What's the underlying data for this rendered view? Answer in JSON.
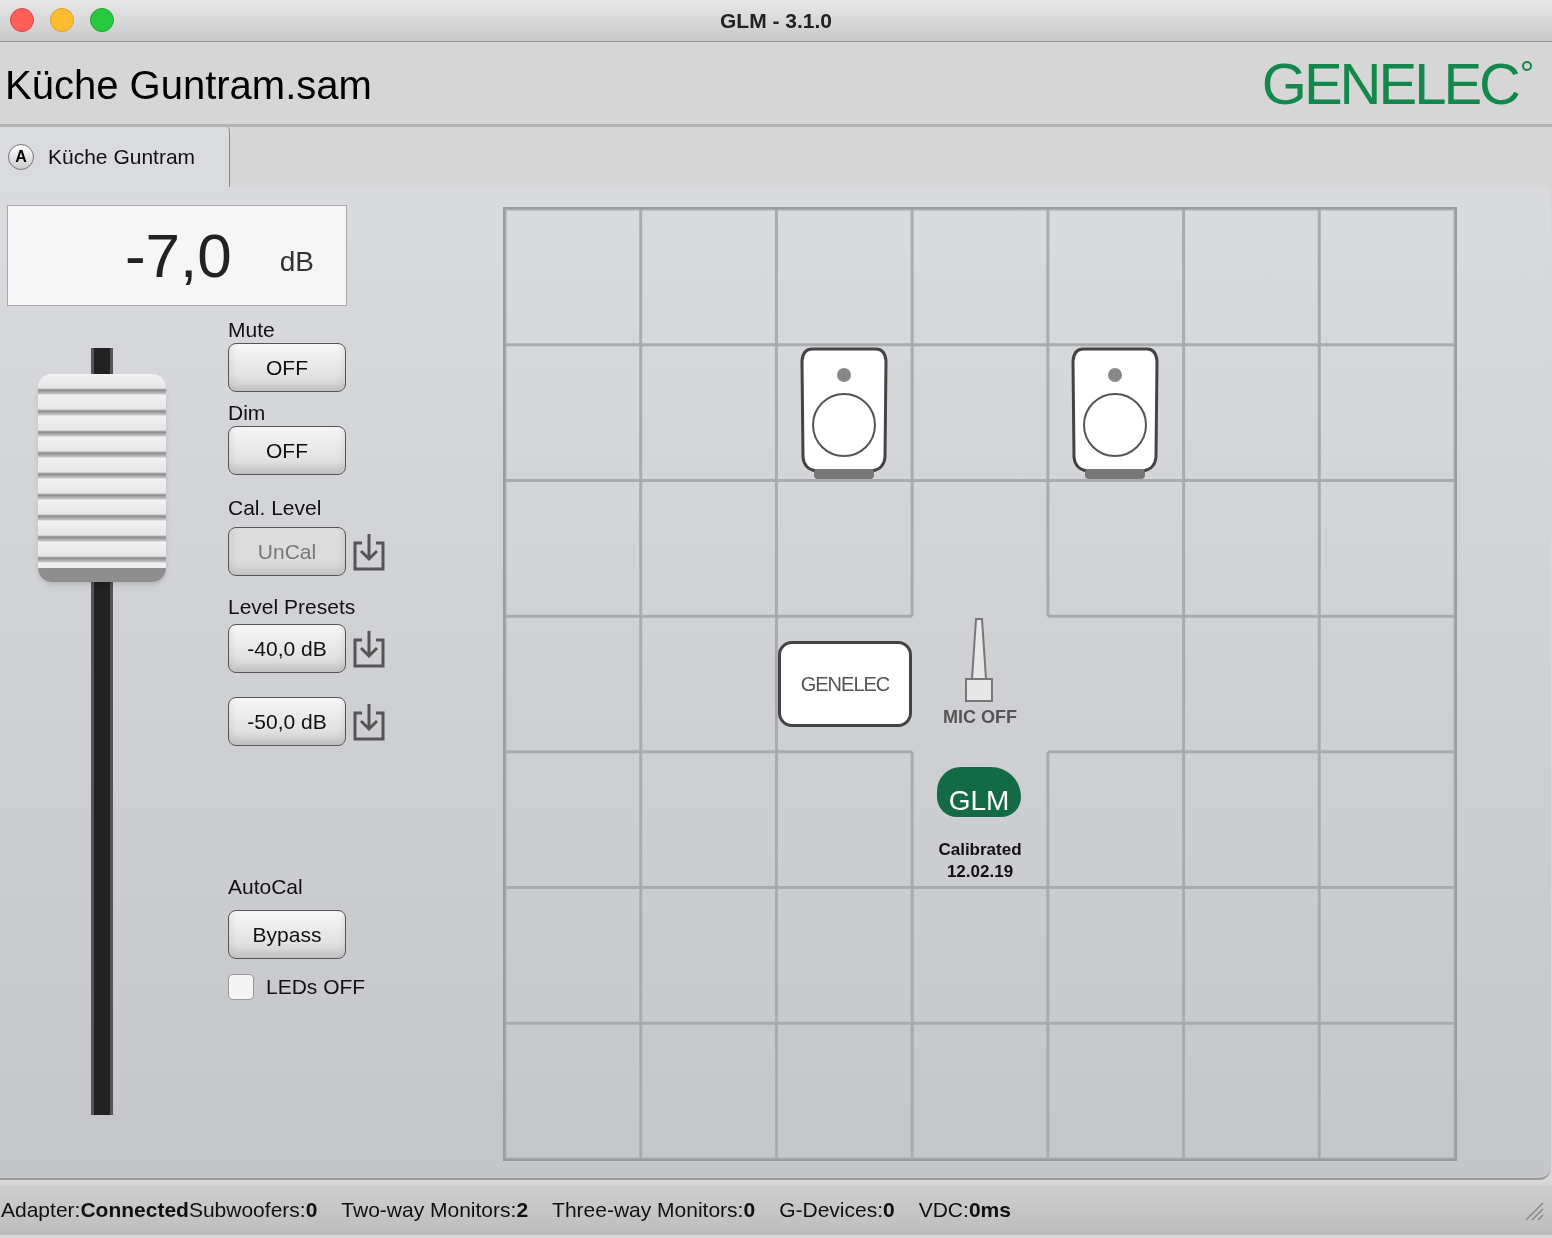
{
  "window": {
    "title": "GLM - 3.1.0"
  },
  "header": {
    "file_name": "Küche Guntram.sam",
    "logo": "GENELEC"
  },
  "tabs": [
    {
      "badge": "A",
      "label": "Küche Guntram",
      "selected": true
    }
  ],
  "level_display": {
    "value": "-7,0",
    "unit": "dB"
  },
  "fader": {
    "level": 0.83
  },
  "mute": {
    "label": "Mute",
    "button": "OFF"
  },
  "dim": {
    "label": "Dim",
    "button": "OFF"
  },
  "cal_level": {
    "label": "Cal. Level",
    "button": "UnCal",
    "disabled": true
  },
  "level_presets": {
    "label": "Level Presets",
    "presets": [
      "-40,0 dB",
      "-50,0 dB"
    ]
  },
  "autocal": {
    "label": "AutoCal",
    "button": "Bypass"
  },
  "leds": {
    "label": "LEDs OFF",
    "checked": false
  },
  "room": {
    "monitors": [
      {
        "kind": "speaker"
      },
      {
        "kind": "speaker"
      }
    ],
    "device_label": "GENELEC",
    "mic": "MIC OFF",
    "cloud_label": "GLM",
    "calibration": [
      "Calibrated",
      "12.02.19"
    ]
  },
  "status_bar": [
    {
      "label": "Adapter:",
      "value": "Connected"
    },
    {
      "label": "Subwoofers:",
      "value": "0"
    },
    {
      "label": "Two-way Monitors:",
      "value": "2"
    },
    {
      "label": "Three-way Monitors:",
      "value": "0"
    },
    {
      "label": "G-Devices:",
      "value": "0"
    },
    {
      "label": "VDC:",
      "value": "0ms"
    }
  ]
}
